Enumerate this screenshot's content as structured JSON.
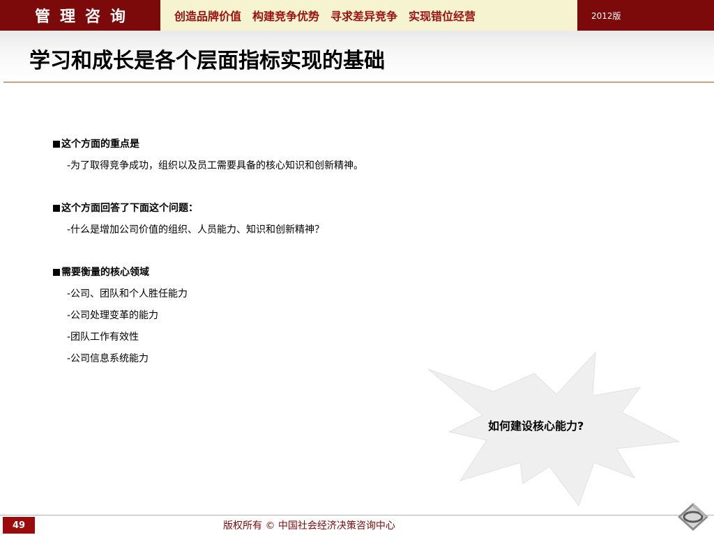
{
  "header": {
    "brand": "管理咨询",
    "slogan": "创造品牌价值　构建竞争优势　寻求差异竞争　实现错位经营",
    "edition": "2012版"
  },
  "title": "学习和成长是各个层面指标实现的基础",
  "sections": [
    {
      "heading": "这个方面的重点是",
      "items": [
        "-为了取得竞争成功，组织以及员工需要具备的核心知识和创新精神。"
      ]
    },
    {
      "heading": "这个方面回答了下面这个问题：",
      "items": [
        "-什么是增加公司价值的组织、人员能力、知识和创新精神？"
      ]
    },
    {
      "heading": "需要衡量的核心领域",
      "items": [
        "-公司、团队和个人胜任能力",
        "-公司处理变革的能力",
        "-团队工作有效性",
        "-公司信息系统能力"
      ]
    }
  ],
  "callout": {
    "text": "如何建设核心能力?"
  },
  "footer": {
    "page_number": "49",
    "copyright": "版权所有 © 中国社会经济决策咨询中心"
  },
  "colors": {
    "header_red": "#7d0a0a",
    "slogan_bg": "#f6f3d0",
    "slogan_text": "#9a1010",
    "title_rule": "#c9a27e",
    "burst_fill": "#efefef"
  },
  "icons": {
    "logo": "diamond-logo-icon",
    "bullet": "black-square-bullet-icon"
  }
}
